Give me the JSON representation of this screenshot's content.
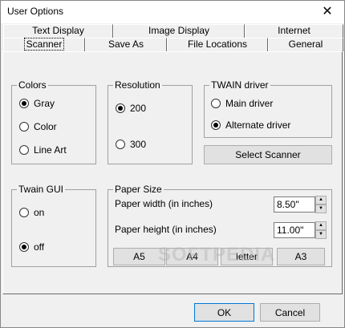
{
  "window": {
    "title": "User Options",
    "close_glyph": "✕"
  },
  "tabs_back": [
    "Text Display",
    "Image Display",
    "Internet"
  ],
  "tabs_front": [
    "Scanner",
    "Save As",
    "File Locations",
    "General"
  ],
  "colors_group": {
    "title": "Colors",
    "options": [
      "Gray",
      "Color",
      "Line Art"
    ],
    "selected": "Gray"
  },
  "resolution_group": {
    "title": "Resolution",
    "options": [
      "200",
      "300"
    ],
    "selected": "200"
  },
  "twain_driver_group": {
    "title": "TWAIN driver",
    "options": [
      "Main driver",
      "Alternate driver"
    ],
    "selected": "Alternate driver"
  },
  "select_scanner_label": "Select Scanner",
  "twain_gui_group": {
    "title": "Twain GUI",
    "options": [
      "on",
      "off"
    ],
    "selected": "off"
  },
  "paper_size_group": {
    "title": "Paper Size",
    "width_label": "Paper width (in inches)",
    "width_value": "8.50\"",
    "height_label": "Paper height (in inches)",
    "height_value": "11.00\"",
    "presets": [
      "A5",
      "A4",
      "letter",
      "A3"
    ]
  },
  "footer": {
    "ok_label": "OK",
    "cancel_label": "Cancel"
  },
  "watermark_text": "SOFTPEDIA"
}
